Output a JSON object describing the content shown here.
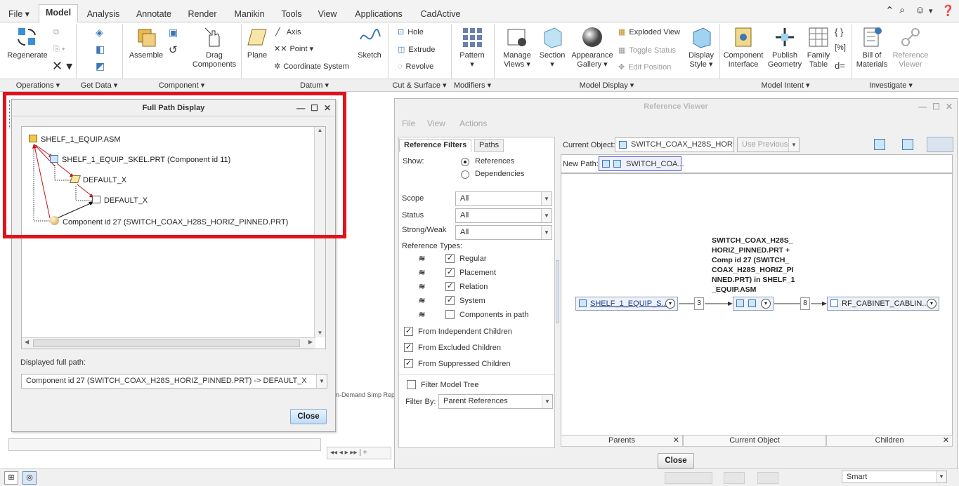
{
  "tabs": {
    "file": "File ▾",
    "model": "Model",
    "analysis": "Analysis",
    "annotate": "Annotate",
    "render": "Render",
    "manikin": "Manikin",
    "tools": "Tools",
    "view": "View",
    "applications": "Applications",
    "cadactive": "CadActive"
  },
  "ribbon": {
    "regenerate": "Regenerate",
    "assemble": "Assemble",
    "drag_components_1": "Drag",
    "drag_components_2": "Components",
    "plane": "Plane",
    "axis": "Axis",
    "point": "Point",
    "coordinate_system": "Coordinate System",
    "sketch": "Sketch",
    "hole": "Hole",
    "extrude": "Extrude",
    "revolve": "Revolve",
    "pattern": "Pattern",
    "manage_views_1": "Manage",
    "manage_views_2": "Views ▾",
    "section": "Section",
    "appearance_gallery_1": "Appearance",
    "appearance_gallery_2": "Gallery ▾",
    "exploded_view": "Exploded View",
    "toggle_status": "Toggle Status",
    "edit_position": "Edit Position",
    "display_style_1": "Display",
    "display_style_2": "Style ▾",
    "component_interface_1": "Component",
    "component_interface_2": "Interface",
    "publish_geometry_1": "Publish",
    "publish_geometry_2": "Geometry",
    "family_table_1": "Family",
    "family_table_2": "Table",
    "bill_of_materials_1": "Bill of",
    "bill_of_materials_2": "Materials",
    "reference_viewer_1": "Reference",
    "reference_viewer_2": "Viewer"
  },
  "groups": {
    "operations": "Operations ▾",
    "get_data": "Get Data ▾",
    "component": "Component ▾",
    "datum": "Datum ▾",
    "cut_surface": "Cut & Surface ▾",
    "modifiers": "Modifiers ▾",
    "model_display": "Model Display ▾",
    "model_intent": "Model Intent ▾",
    "investigate": "Investigate ▾"
  },
  "full_path_dialog": {
    "title": "Full Path Display",
    "tree": {
      "root": "SHELF_1_EQUIP.ASM",
      "skel": "SHELF_1_EQUIP_SKEL.PRT (Component id 11)",
      "default_x_1": "DEFAULT_X",
      "default_x_2": "DEFAULT_X",
      "component": "Component id 27 (SWITCH_COAX_H28S_HORIZ_PINNED.PRT)"
    },
    "displayed_full_path_label": "Displayed full path:",
    "displayed_full_path_value": "Component id 27 (SWITCH_COAX_H28S_HORIZ_PINNED.PRT) -> DEFAULT_X",
    "close": "Close"
  },
  "background": {
    "on_demand": "n-Demand Simp Rep"
  },
  "reference_viewer": {
    "title": "Reference Viewer",
    "menu_file": "File",
    "menu_view": "View",
    "menu_actions": "Actions",
    "tab_filters": "Reference Filters",
    "tab_paths": "Paths",
    "show_label": "Show:",
    "show_references": "References",
    "show_dependencies": "Dependencies",
    "scope_label": "Scope",
    "scope_value": "All",
    "status_label": "Status",
    "status_value": "All",
    "strong_weak_label": "Strong/Weak",
    "strong_weak_value": "All",
    "reference_types_label": "Reference Types:",
    "types": [
      "Regular",
      "Placement",
      "Relation",
      "System",
      "Components in path"
    ],
    "from_independent": "From Independent Children",
    "from_excluded": "From Excluded Children",
    "from_suppressed": "From Suppressed Children",
    "filter_model_tree": "Filter Model Tree",
    "filter_by_label": "Filter By:",
    "filter_by_value": "Parent References",
    "current_object_label": "Current Object:",
    "current_object_value": "SWITCH_COAX_H28S_HORI...",
    "use_previous": "Use Previous",
    "new_path_label": "New Path:",
    "new_path_value": "SWITCH_COA...",
    "node_left": "SHELF_1_EQUIP_S...",
    "node_right": "RF_CABINET_CABLIN...",
    "count_left": "3",
    "count_right": "8",
    "node_caption": "SWITCH_COAX_H28S_\nHORIZ_PINNED.PRT +\nComp id 27 (SWITCH_\nCOAX_H28S_HORIZ_PI\nNNED.PRT) in SHELF_1\n_EQUIP.ASM",
    "col_parents": "Parents",
    "col_current": "Current Object",
    "col_children": "Children",
    "close": "Close"
  },
  "statusbar": {
    "smart": "Smart"
  },
  "colors": {
    "highlight_box": "#e3121b",
    "node_fill": "#eef2f8",
    "button_blue": "#bfdcf5"
  }
}
